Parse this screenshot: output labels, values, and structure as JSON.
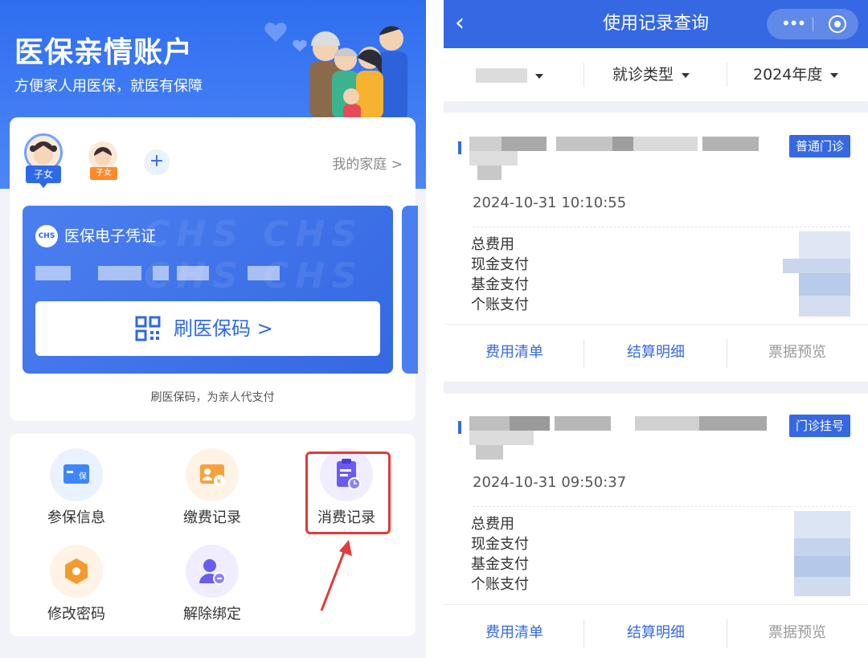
{
  "left_panel": {
    "title": "医保亲情账户",
    "subtitle": "方便家人用医保，就医有保障",
    "family": {
      "active_member_tag": "子女",
      "second_member_tag": "子女",
      "add_label": "+",
      "my_family_link": "我的家庭 >"
    },
    "voucher": {
      "logo_text": "CHS",
      "title": "医保电子凭证",
      "watermark": "CHS CHS CHS CHS",
      "scan_button_label": "刷医保码 >",
      "caption": "刷医保码，为亲人代支付"
    },
    "services": [
      {
        "label": "参保信息",
        "icon": "insurance-card-icon",
        "color": "#3e86f5"
      },
      {
        "label": "缴费记录",
        "icon": "payment-record-icon",
        "color": "#f5a23e"
      },
      {
        "label": "消费记录",
        "icon": "consumption-record-icon",
        "color": "#6a5cf0"
      },
      {
        "label": "修改密码",
        "icon": "hexagon-lock-icon",
        "color": "#f59b2e"
      },
      {
        "label": "解除绑定",
        "icon": "unbind-user-icon",
        "color": "#6a5cf0"
      }
    ],
    "highlight_color": "#e53935"
  },
  "right_panel": {
    "nav": {
      "back_icon": "‹",
      "title": "使用记录查询",
      "more_icon": "•••"
    },
    "filters": {
      "visit_type": "就诊类型",
      "year": "2024年度"
    },
    "records": [
      {
        "badge": "普通门诊",
        "time": "2024-10-31 10:10:55",
        "fee_labels": [
          "总费用",
          "现金支付",
          "基金支付",
          "个账支付"
        ],
        "actions": [
          "费用清单",
          "结算明细",
          "票据预览"
        ]
      },
      {
        "badge": "门诊挂号",
        "time": "2024-10-31 09:50:37",
        "fee_labels": [
          "总费用",
          "现金支付",
          "基金支付",
          "个账支付"
        ],
        "actions": [
          "费用清单",
          "结算明细",
          "票据预览"
        ]
      }
    ],
    "accent": "#3568e2"
  }
}
